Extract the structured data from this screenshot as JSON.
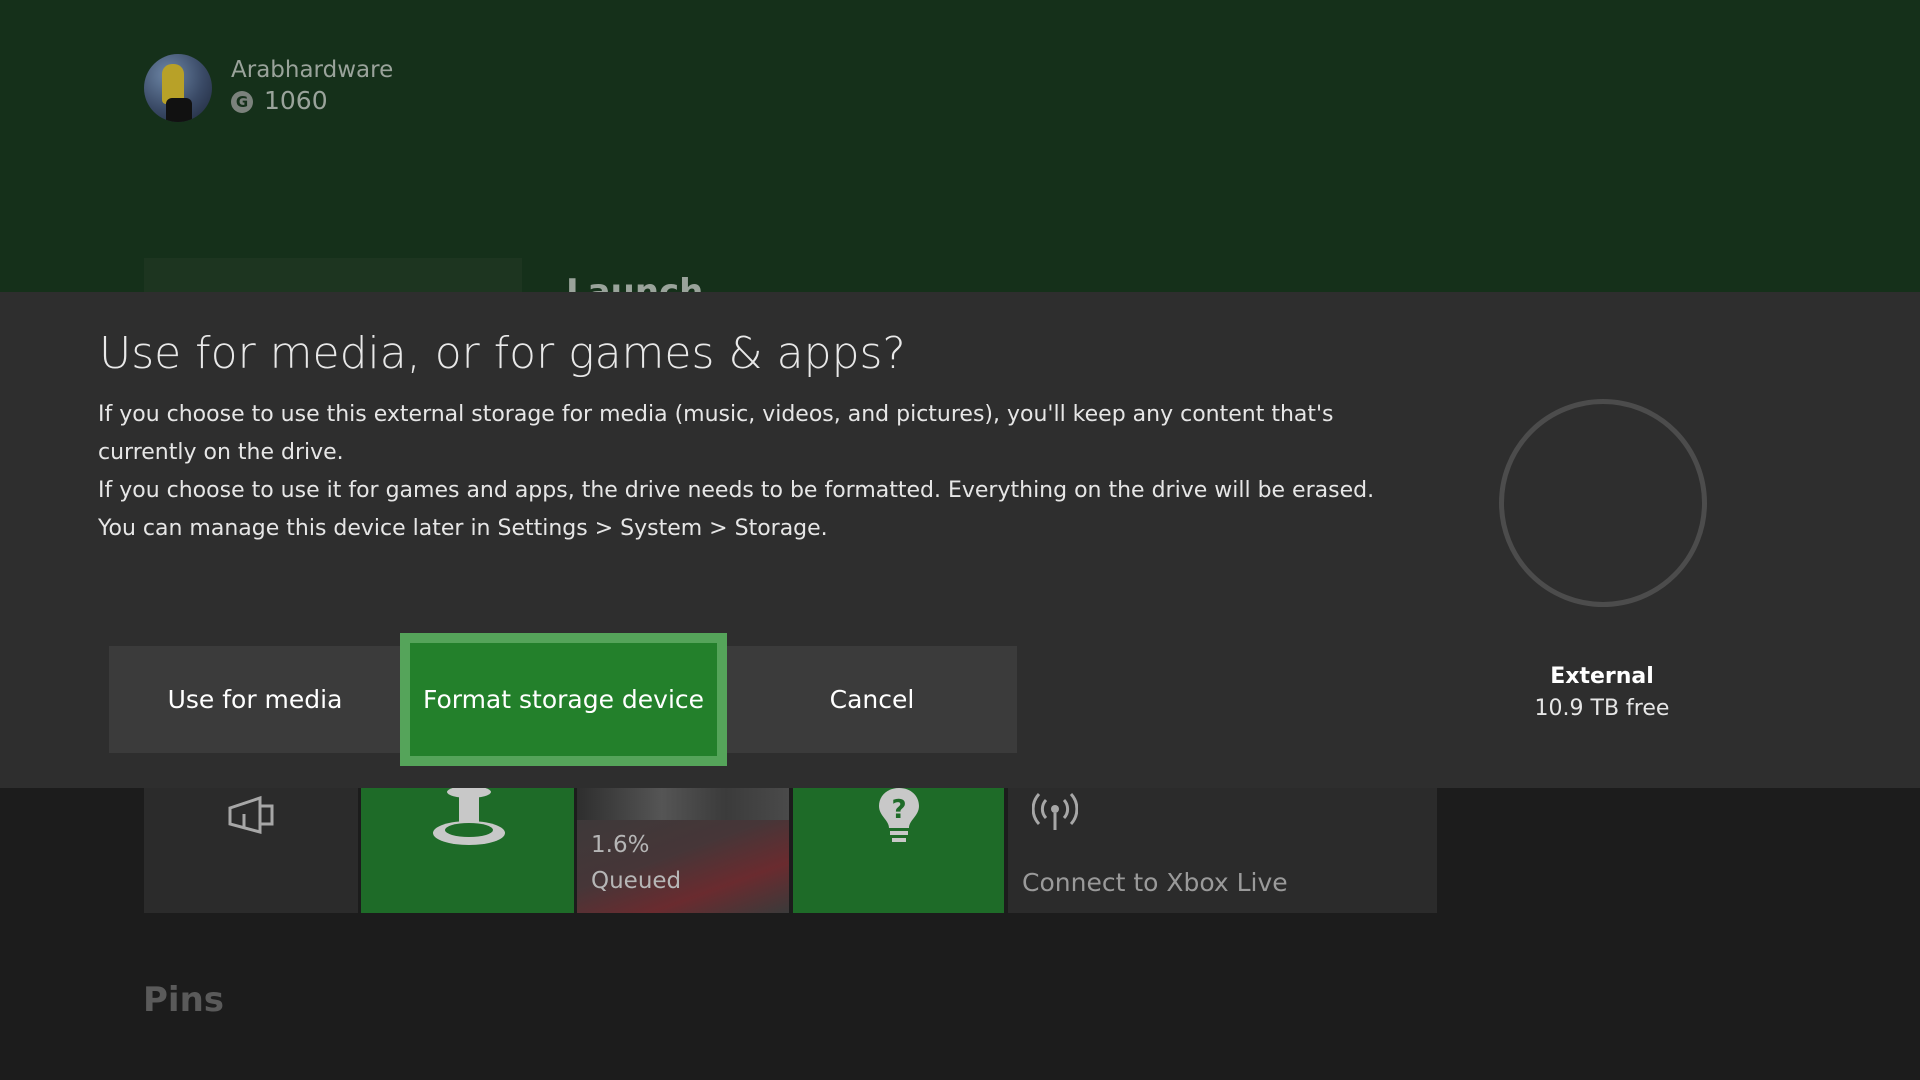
{
  "profile": {
    "gamertag": "Arabhardware",
    "gamerscore_icon": "G",
    "gamerscore": "1060"
  },
  "home": {
    "launch_label": "Launch",
    "pins_label": "Pins",
    "tiles": {
      "download_progress": "1.6%",
      "download_status": "Queued",
      "connect_label": "Connect to Xbox Live"
    },
    "icons": [
      "store-icon",
      "trophy-icon",
      "game-art",
      "tips-icon",
      "wireless-icon"
    ]
  },
  "dialog": {
    "title": "Use for media, or for games & apps?",
    "paragraphs": [
      "If you choose to use this external storage for media (music, videos, and pictures), you'll keep any content that's currently on the drive.",
      "If you choose to use it for games and apps, the drive needs to be formatted. Everything on the drive will be erased.",
      "You can manage this device later in Settings > System > Storage."
    ],
    "buttons": {
      "media": "Use for media",
      "format": "Format storage device",
      "cancel": "Cancel"
    },
    "storage": {
      "name": "External",
      "free": "10.9 TB free"
    }
  },
  "colors": {
    "background_top": "#15301a",
    "dialog": "#2e2e2e",
    "accent_green": "#23802b",
    "focus_border": "#55a45a"
  }
}
